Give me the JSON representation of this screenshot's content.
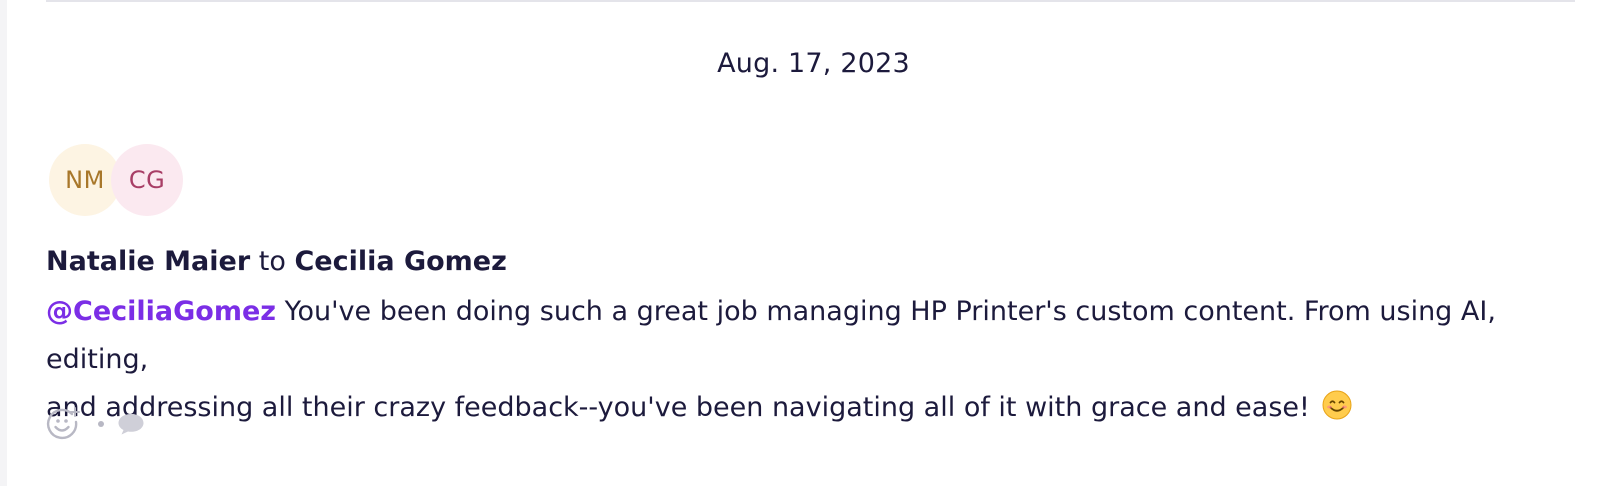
{
  "feed_item": {
    "date": "Aug. 17, 2023",
    "avatars": [
      {
        "initials": "NM",
        "color": "#a8772a",
        "background": "#fdf4e3"
      },
      {
        "initials": "CG",
        "color": "#a83e66",
        "background": "#fbe9f0"
      }
    ],
    "sender": "Natalie Maier",
    "connector": "to",
    "recipient": "Cecilia Gomez",
    "message": {
      "mention": "@CeciliaGomez",
      "text_line1": " You've been doing such a great job managing HP Printer's custom content. From using AI,  editing,",
      "text_line2": "and addressing all their crazy feedback--you've been navigating all of it with grace and ease!",
      "emoji": "smiling-face-emoji"
    },
    "actions": {
      "react_icon": "add-reaction-icon",
      "comment_icon": "comment-bubble-icon"
    }
  },
  "colors": {
    "text": "#1c1a3c",
    "mention": "#7b2ee6",
    "icon_gray": "#b8b8c4"
  }
}
